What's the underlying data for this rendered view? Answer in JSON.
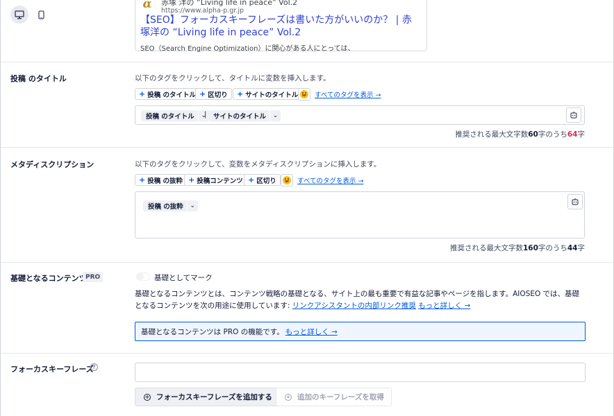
{
  "preview": {
    "site_name": "赤塚 洋の “Living life in peace” Vol.2",
    "url": "https://www.alpha-p.gr.jp",
    "title": "【SEO】フォーカスキーフレーズは書いた方がいいのか？ | 赤塚洋の “Living life in peace” Vol.2",
    "description": "SEO（Search Engine Optimization）に関心がある人にとっては、",
    "favicon_letter": "α"
  },
  "devices": {
    "desktop": "desktop-icon",
    "mobile": "mobile-icon",
    "active": "desktop"
  },
  "post_title": {
    "label": "投稿 のタイトル",
    "help": "以下のタグをクリックして、タイトルに変数を挿入します。",
    "tags": [
      "投稿 のタイトル",
      "区切り",
      "サイトのタイトル"
    ],
    "show_all": "すべてのタグを表示 →",
    "chips": [
      "投稿 のタイトル",
      "サイトのタイトル"
    ],
    "separator": "|",
    "count_prefix": "推奨される最大文字数",
    "count_max": "60",
    "count_mid": "字のうち",
    "count_current": "64",
    "count_suffix": "字"
  },
  "meta_description": {
    "label": "メタディスクリプション",
    "help": "以下のタグをクリックして、変数をメタディスクリプションに挿入します。",
    "tags": [
      "投稿 の抜粋",
      "投稿コンテンツ",
      "区切り"
    ],
    "show_all": "すべてのタグを表示 →",
    "chips": [
      "投稿 の抜粋"
    ],
    "count_prefix": "推奨される最大文字数",
    "count_max": "160",
    "count_mid": "字のうち",
    "count_current": "44",
    "count_suffix": "字"
  },
  "cornerstone": {
    "label": "基礎となるコンテンツ",
    "badge": "PRO",
    "toggle_label": "基礎としてマーク",
    "toggle_on": false,
    "para_text": "基礎となるコンテンツとは、コンテンツ戦略の基礎となる、サイト上の最も重要で有益な記事やページを指します。AIOSEO では、基礎となるコンテンツを次の用途に使用しています: ",
    "para_link": "リンクアシスタントの内部リンク推奨",
    "learn_more": "もっと詳しく →",
    "notice_text": "基礎となるコンテンツは PRO の機能です。",
    "notice_link": "もっと詳しく →"
  },
  "focus_keyphrase": {
    "label": "フォーカスキーフレーズ",
    "help_icon": "?",
    "input_value": "",
    "add_button": "フォーカスキーフレーズを追加する",
    "additional_button": "追加のキーフレーズを取得"
  },
  "colors": {
    "accent": "#005ae0",
    "warning": "#df2a4a",
    "link_title": "#2d3fd6"
  }
}
